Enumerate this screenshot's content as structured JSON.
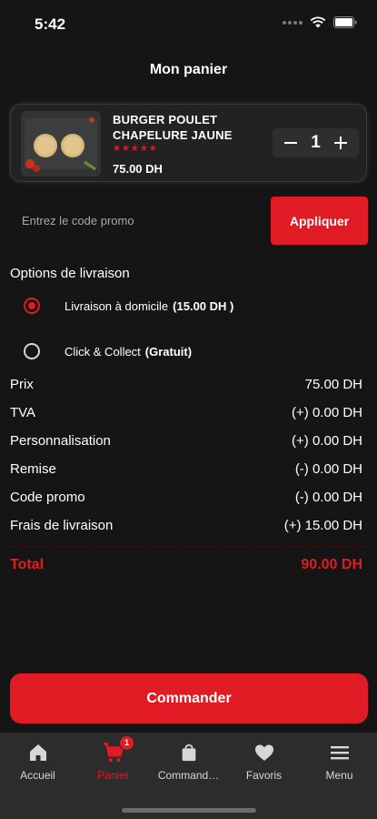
{
  "status": {
    "time": "5:42"
  },
  "header": {
    "title": "Mon panier"
  },
  "cart_item": {
    "name": "BURGER POULET CHAPELURE JAUNE",
    "stars": "★★★★★",
    "price": "75.00 DH",
    "quantity": "1",
    "minus": "−",
    "plus": "+"
  },
  "promo": {
    "placeholder": "Entrez le code promo",
    "apply_label": "Appliquer"
  },
  "delivery": {
    "title": "Options de livraison",
    "options": [
      {
        "label": "Livraison à domicile",
        "price": "(15.00 DH )",
        "selected": true
      },
      {
        "label": "Click & Collect",
        "price": "(Gratuit)",
        "selected": false
      }
    ]
  },
  "summary": {
    "rows": [
      {
        "label": "Prix",
        "value": "75.00 DH"
      },
      {
        "label": "TVA",
        "value": "(+) 0.00 DH"
      },
      {
        "label": "Personnalisation",
        "value": "(+) 0.00 DH"
      },
      {
        "label": "Remise",
        "value": "(-) 0.00 DH"
      },
      {
        "label": "Code promo",
        "value": "(-) 0.00 DH"
      },
      {
        "label": "Frais de livraison",
        "value": "(+) 15.00 DH"
      }
    ],
    "total_label": "Total",
    "total_value": "90.00 DH"
  },
  "order_button": "Commander",
  "tabs": [
    {
      "label": "Accueil",
      "icon": "home-icon",
      "active": false
    },
    {
      "label": "Panier",
      "icon": "cart-icon",
      "active": true,
      "badge": "1"
    },
    {
      "label": "Command…",
      "icon": "bag-icon",
      "active": false
    },
    {
      "label": "Favoris",
      "icon": "heart-icon",
      "active": false
    },
    {
      "label": "Menu",
      "icon": "menu-icon",
      "active": false
    }
  ],
  "colors": {
    "accent": "#e01b24",
    "background": "#151515",
    "tab_bar": "#2c2c2c"
  }
}
